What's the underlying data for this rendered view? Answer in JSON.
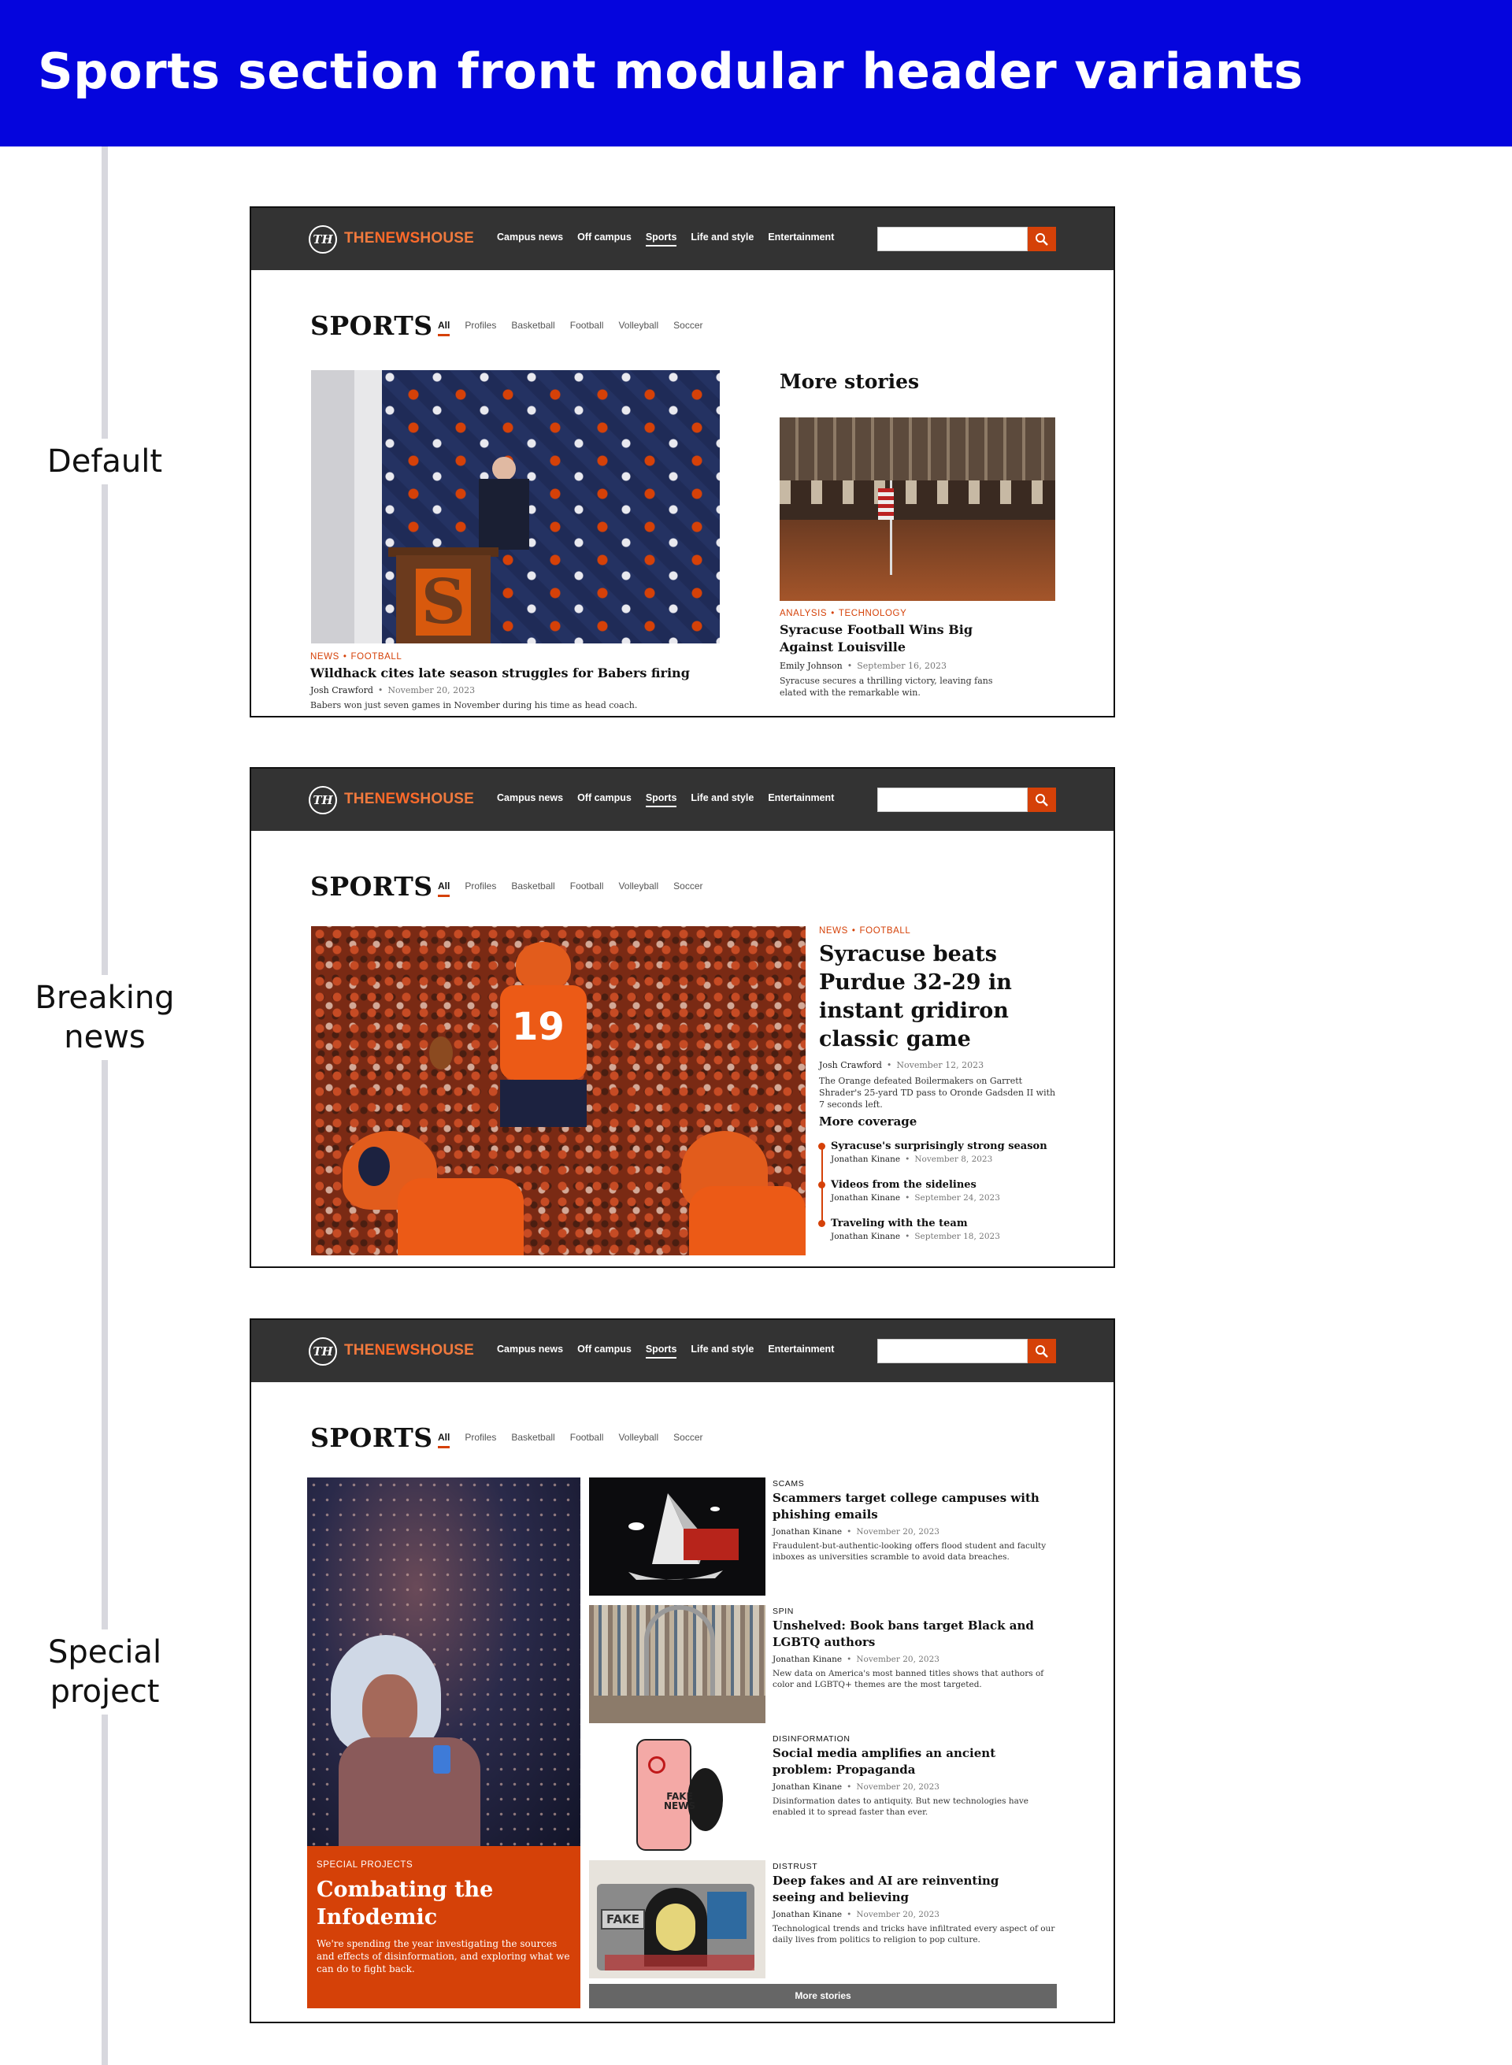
{
  "page_title": "Sports section front modular header variants",
  "variant_labels": {
    "default": "Default",
    "breaking_1": "Breaking",
    "breaking_2": "news",
    "special_1": "Special",
    "special_2": "project"
  },
  "nav": {
    "logo_mark": "TH",
    "brand_the": "THE",
    "brand_news": "NEWS",
    "brand_house": "HOUSE",
    "links": [
      "Campus news",
      "Off campus",
      "Sports",
      "Life and style",
      "Entertainment"
    ],
    "active_link": "Sports",
    "search_placeholder": ""
  },
  "section": {
    "title": "SPORTS",
    "tabs": [
      "All",
      "Profiles",
      "Basketball",
      "Football",
      "Volleyball",
      "Soccer"
    ],
    "active_tab": "All"
  },
  "default": {
    "lead": {
      "kicker_1": "NEWS",
      "kicker_2": "FOOTBALL",
      "headline": "Wildhack cites late season struggles for Babers firing",
      "author": "Josh Crawford",
      "date": "November 20, 2023",
      "summary": "Babers won just seven games in November during his time as head coach."
    },
    "more_title": "More stories",
    "more": {
      "kicker_1": "ANALYSIS",
      "kicker_2": "TECHNOLOGY",
      "headline": "Syracuse Football Wins Big Against Louisville",
      "author": "Emily Johnson",
      "date": "September 16, 2023",
      "summary": "Syracuse secures a thrilling victory, leaving fans elated with the remarkable win."
    }
  },
  "breaking": {
    "kicker_1": "NEWS",
    "kicker_2": "FOOTBALL",
    "headline": "Syracuse beats Purdue 32-29 in instant gridiron classic game",
    "author": "Josh Crawford",
    "date": "November 12, 2023",
    "summary": "The Orange defeated Boilermakers on Garrett Shrader's 25-yard TD pass to Oronde Gadsden II with 7 seconds left.",
    "coverage_title": "More coverage",
    "coverage": [
      {
        "title": "Syracuse's surprisingly strong season",
        "author": "Jonathan Kinane",
        "date": "November 8, 2023"
      },
      {
        "title": "Videos from the sidelines",
        "author": "Jonathan Kinane",
        "date": "September 24, 2023"
      },
      {
        "title": "Traveling with the team",
        "author": "Jonathan Kinane",
        "date": "September 18, 2023"
      }
    ]
  },
  "special": {
    "feature": {
      "kicker": "SPECIAL PROJECTS",
      "headline": "Combating the Infodemic",
      "summary": "We're spending the year investigating the sources and effects of disinformation, and exploring what we can do to fight back."
    },
    "stories": [
      {
        "kicker": "SCAMS",
        "headline": "Scammers target college campuses with phishing emails",
        "author": "Jonathan Kinane",
        "date": "November 20, 2023",
        "summary": "Fraudulent-but-authentic-looking offers flood student and faculty inboxes as universities scramble to avoid data breaches."
      },
      {
        "kicker": "SPIN",
        "headline": "Unshelved: Book bans target Black and LGBTQ authors",
        "author": "Jonathan Kinane",
        "date": "November 20, 2023",
        "summary": "New data on America's most banned titles shows that authors of color and LGBTQ+ themes are the most targeted."
      },
      {
        "kicker": "DISINFORMATION",
        "headline": "Social media amplifies an ancient problem: Propaganda",
        "author": "Jonathan Kinane",
        "date": "November 20, 2023",
        "summary": "Disinformation dates to antiquity. But new technologies have enabled it to spread faster than ever."
      },
      {
        "kicker": "DISTRUST",
        "headline": "Deep fakes and AI are reinventing seeing and believing",
        "author": "Jonathan Kinane",
        "date": "November 20, 2023",
        "summary": "Technological trends and tricks have infiltrated every aspect of our daily lives from politics to religion to pop culture."
      }
    ],
    "more_button": "More stories",
    "image_text_fake": "FAKE",
    "image_text_fake_news": "FAKE NEWS"
  },
  "colors": {
    "banner": "#0505dd",
    "accent": "#d54108",
    "nav_bg": "#333333"
  }
}
